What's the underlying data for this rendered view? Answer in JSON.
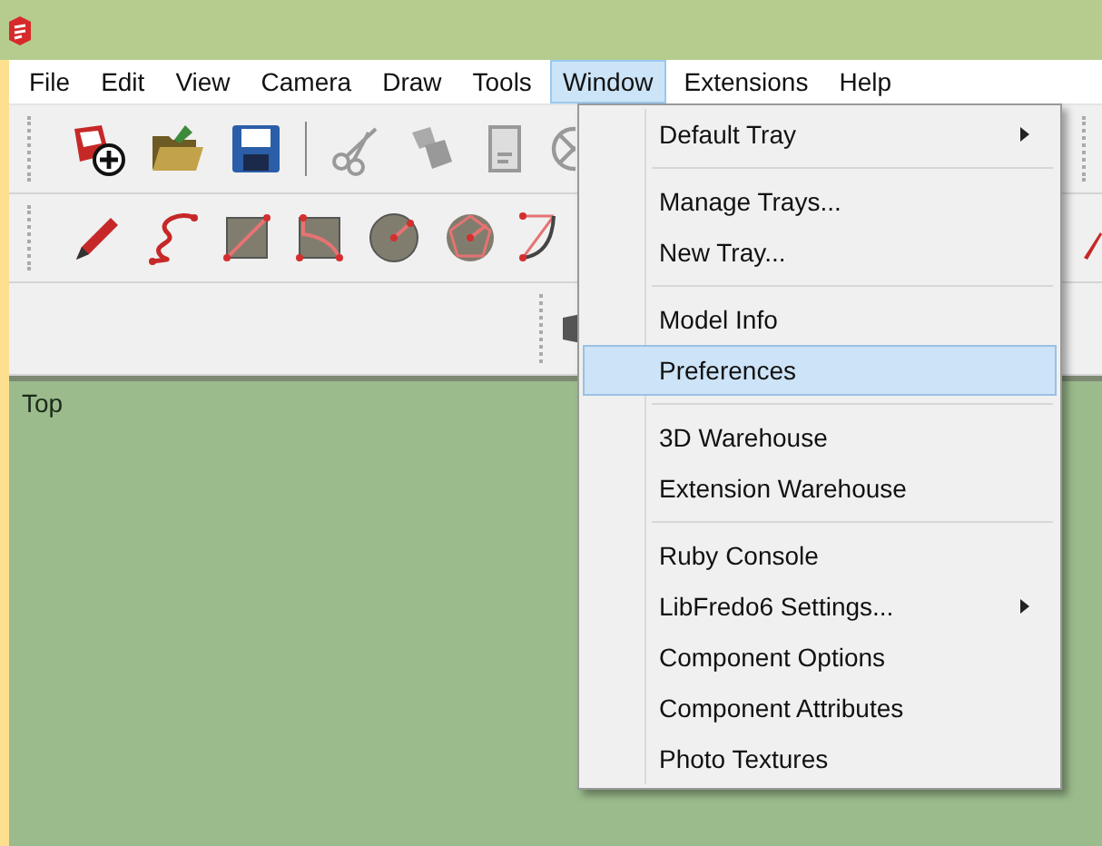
{
  "menu_bar": [
    {
      "label": "File",
      "selected": false
    },
    {
      "label": "Edit",
      "selected": false
    },
    {
      "label": "View",
      "selected": false
    },
    {
      "label": "Camera",
      "selected": false
    },
    {
      "label": "Draw",
      "selected": false
    },
    {
      "label": "Tools",
      "selected": false
    },
    {
      "label": "Window",
      "selected": true
    },
    {
      "label": "Extensions",
      "selected": false
    },
    {
      "label": "Help",
      "selected": false
    }
  ],
  "window_menu": [
    [
      {
        "label": "Default Tray",
        "submenu": true,
        "selected": false
      }
    ],
    [
      {
        "label": "Manage Trays...",
        "submenu": false,
        "selected": false
      },
      {
        "label": "New Tray...",
        "submenu": false,
        "selected": false
      }
    ],
    [
      {
        "label": "Model Info",
        "submenu": false,
        "selected": false
      },
      {
        "label": "Preferences",
        "submenu": false,
        "selected": true
      }
    ],
    [
      {
        "label": "3D Warehouse",
        "submenu": false,
        "selected": false
      },
      {
        "label": "Extension Warehouse",
        "submenu": false,
        "selected": false
      }
    ],
    [
      {
        "label": "Ruby Console",
        "submenu": false,
        "selected": false
      },
      {
        "label": "LibFredo6 Settings...",
        "submenu": true,
        "selected": false
      },
      {
        "label": "Component Options",
        "submenu": false,
        "selected": false
      },
      {
        "label": "Component Attributes",
        "submenu": false,
        "selected": false
      },
      {
        "label": "Photo Textures",
        "submenu": false,
        "selected": false
      }
    ]
  ],
  "viewport": {
    "label": "Top"
  }
}
